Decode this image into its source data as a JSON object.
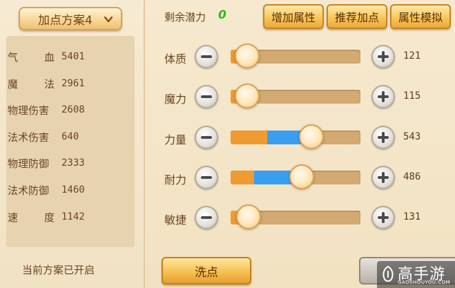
{
  "left_panel": {
    "plan_dropdown_label": "加点方案4",
    "stats": [
      {
        "name_a": "气",
        "name_b": "血",
        "value": "5401"
      },
      {
        "name_a": "魔",
        "name_b": "法",
        "value": "2961"
      },
      {
        "name": "物理伤害",
        "value": "2608"
      },
      {
        "name": "法术伤害",
        "value": "640"
      },
      {
        "name": "物理防御",
        "value": "2333"
      },
      {
        "name": "法术防御",
        "value": "1460"
      },
      {
        "name_a": "速",
        "name_b": "度",
        "value": "1142"
      }
    ],
    "current_plan_status": "当前方案已开启"
  },
  "header": {
    "potential_label": "剩余潜力",
    "potential_value": "0",
    "buttons": {
      "add_attr": "增加属性",
      "recommend": "推荐加点",
      "simulate": "属性模拟"
    }
  },
  "attributes": [
    {
      "label": "体质",
      "value": "121",
      "orange_fraction": 0.07,
      "blue_fraction": 0.0,
      "thumb_fraction": 0.13
    },
    {
      "label": "魔力",
      "value": "115",
      "orange_fraction": 0.07,
      "blue_fraction": 0.0,
      "thumb_fraction": 0.13
    },
    {
      "label": "力量",
      "value": "543",
      "orange_fraction": 0.28,
      "blue_fraction": 0.31,
      "thumb_fraction": 0.62
    },
    {
      "label": "耐力",
      "value": "486",
      "orange_fraction": 0.18,
      "blue_fraction": 0.36,
      "thumb_fraction": 0.55
    },
    {
      "label": "敏捷",
      "value": "131",
      "orange_fraction": 0.07,
      "blue_fraction": 0.0,
      "thumb_fraction": 0.14
    }
  ],
  "footer": {
    "wash_button": "洗点"
  },
  "watermark": {
    "brand": "高手游",
    "url": "GAOSHOUYOU.COM"
  },
  "colors": {
    "orange_fill": "#f09a32",
    "blue_fill": "#3a9ef0",
    "track": "#d3aa72",
    "potential_green": "#2fb81f"
  }
}
